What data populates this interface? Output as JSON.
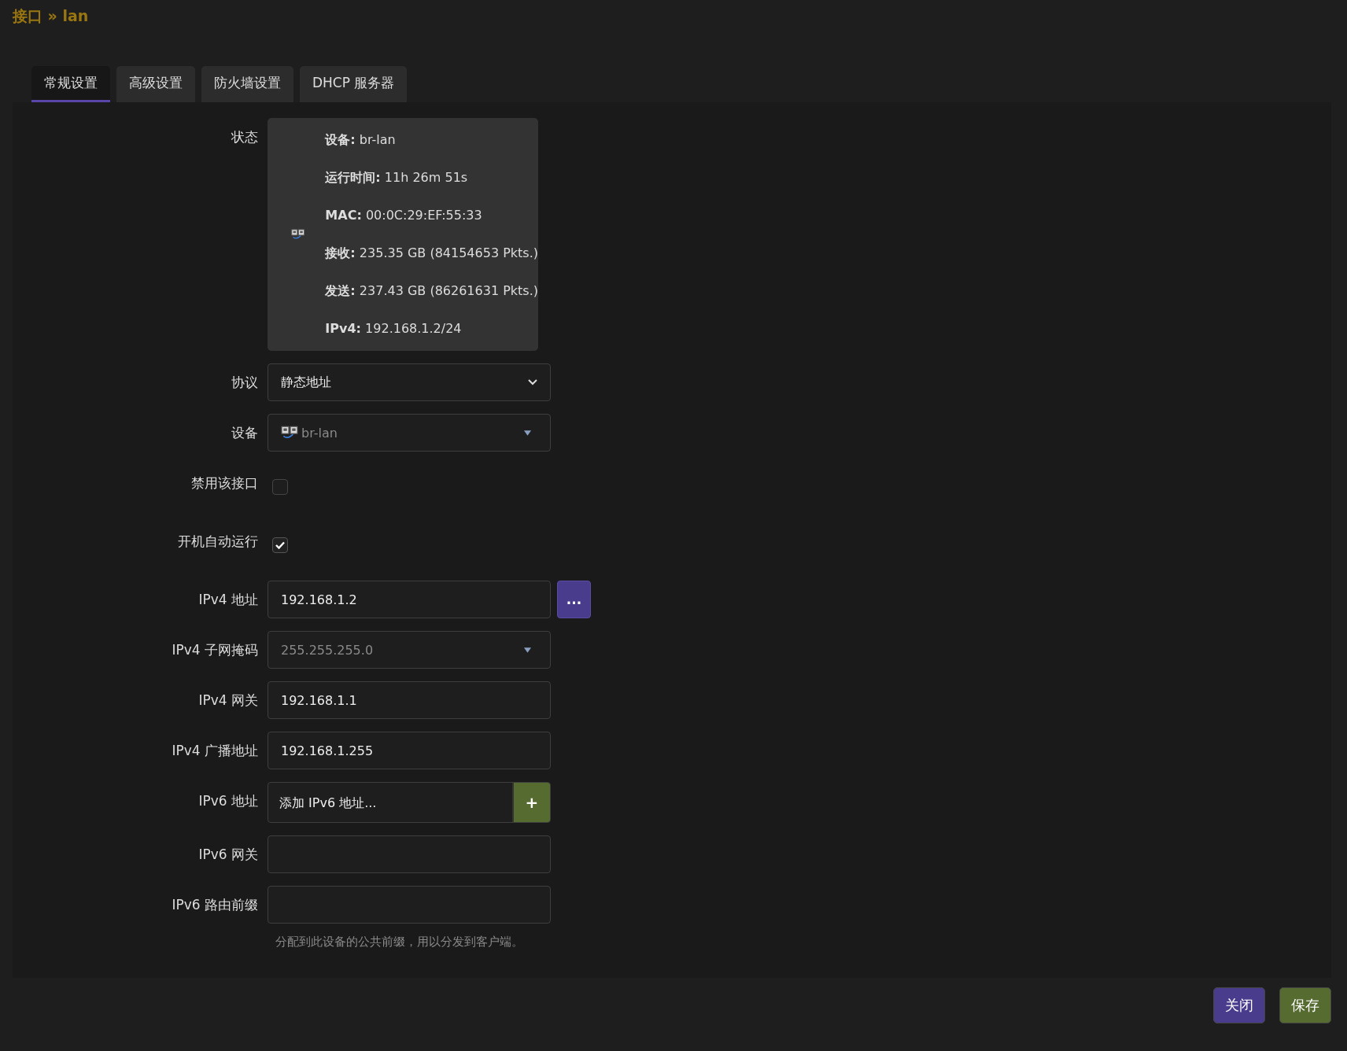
{
  "title": "接口 » lan",
  "tabs": [
    {
      "label": "常规设置",
      "selected": true
    },
    {
      "label": "高级设置",
      "selected": false
    },
    {
      "label": "防火墙设置",
      "selected": false
    },
    {
      "label": "DHCP 服务器",
      "selected": false
    }
  ],
  "status": {
    "label": "状态",
    "lines": [
      {
        "key": "设备:",
        "value": "br-lan"
      },
      {
        "key": "运行时间:",
        "value": "11h 26m 51s"
      },
      {
        "key": "MAC:",
        "value": "00:0C:29:EF:55:33"
      },
      {
        "key": "接收:",
        "value": "235.35 GB (84154653 Pkts.)"
      },
      {
        "key": "发送:",
        "value": "237.43 GB (86261631 Pkts.)"
      },
      {
        "key": "IPv4:",
        "value": "192.168.1.2/24"
      }
    ]
  },
  "fields": [
    {
      "kind": "select",
      "label": "协议",
      "value": "静态地址"
    },
    {
      "kind": "device-combo",
      "label": "设备",
      "value": "br-lan"
    },
    {
      "kind": "checkbox",
      "label": "禁用该接口",
      "checked": false
    },
    {
      "kind": "checkbox",
      "label": "开机自动运行",
      "checked": true
    },
    {
      "kind": "text",
      "label": "IPv4 地址",
      "value": "192.168.1.2",
      "button": "..."
    },
    {
      "kind": "combo",
      "label": "IPv4 子网掩码",
      "value": "255.255.255.0"
    },
    {
      "kind": "text",
      "label": "IPv4 网关",
      "value": "192.168.1.1"
    },
    {
      "kind": "text",
      "label": "IPv4 广播地址",
      "value": "192.168.1.255"
    },
    {
      "kind": "dynlist",
      "label": "IPv6 地址",
      "placeholder": "添加 IPv6 地址...",
      "button": "+"
    },
    {
      "kind": "text",
      "label": "IPv6 网关"
    },
    {
      "kind": "text",
      "label": "IPv6 路由前缀",
      "hint": "分配到此设备的公共前缀，用以分发到客户端。"
    }
  ],
  "buttons": [
    {
      "kind": "close",
      "label": "关闭"
    },
    {
      "kind": "save",
      "label": "保存"
    }
  ]
}
